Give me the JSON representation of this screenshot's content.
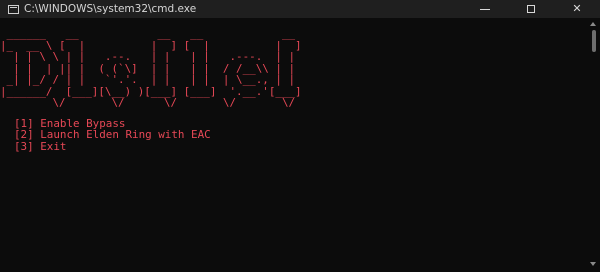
{
  "window": {
    "title": "C:\\WINDOWS\\system32\\cmd.exe",
    "controls": {
      "close_glyph": "✕"
    }
  },
  "colors": {
    "console_background": "#0c0c0c",
    "titlebar_background": "#1f1f1f",
    "text_red": "#e74856",
    "title_text": "#d6d6d6"
  },
  "console": {
    "ascii_banner": " ______   __            __   __            __\n|_  __ \\ [  |          |  ] [  |          |  ]\n  | | \\ \\ | |   .--.   | |   | |   .---.  | |\n  | |  | || |  ( (`\\]  | |   | |  / /__\\\\ | |\n _| |_/ / | |   `'.'.  | |   | |  | \\__., | |\n|______/  [___][\\__) )[___] [___]  '.__.'[___]\n        \\/       \\/      \\/       \\/       \\/",
    "menu": [
      "[1] Enable Bypass",
      "[2] Launch Elden Ring with EAC",
      "[3] Exit"
    ]
  }
}
